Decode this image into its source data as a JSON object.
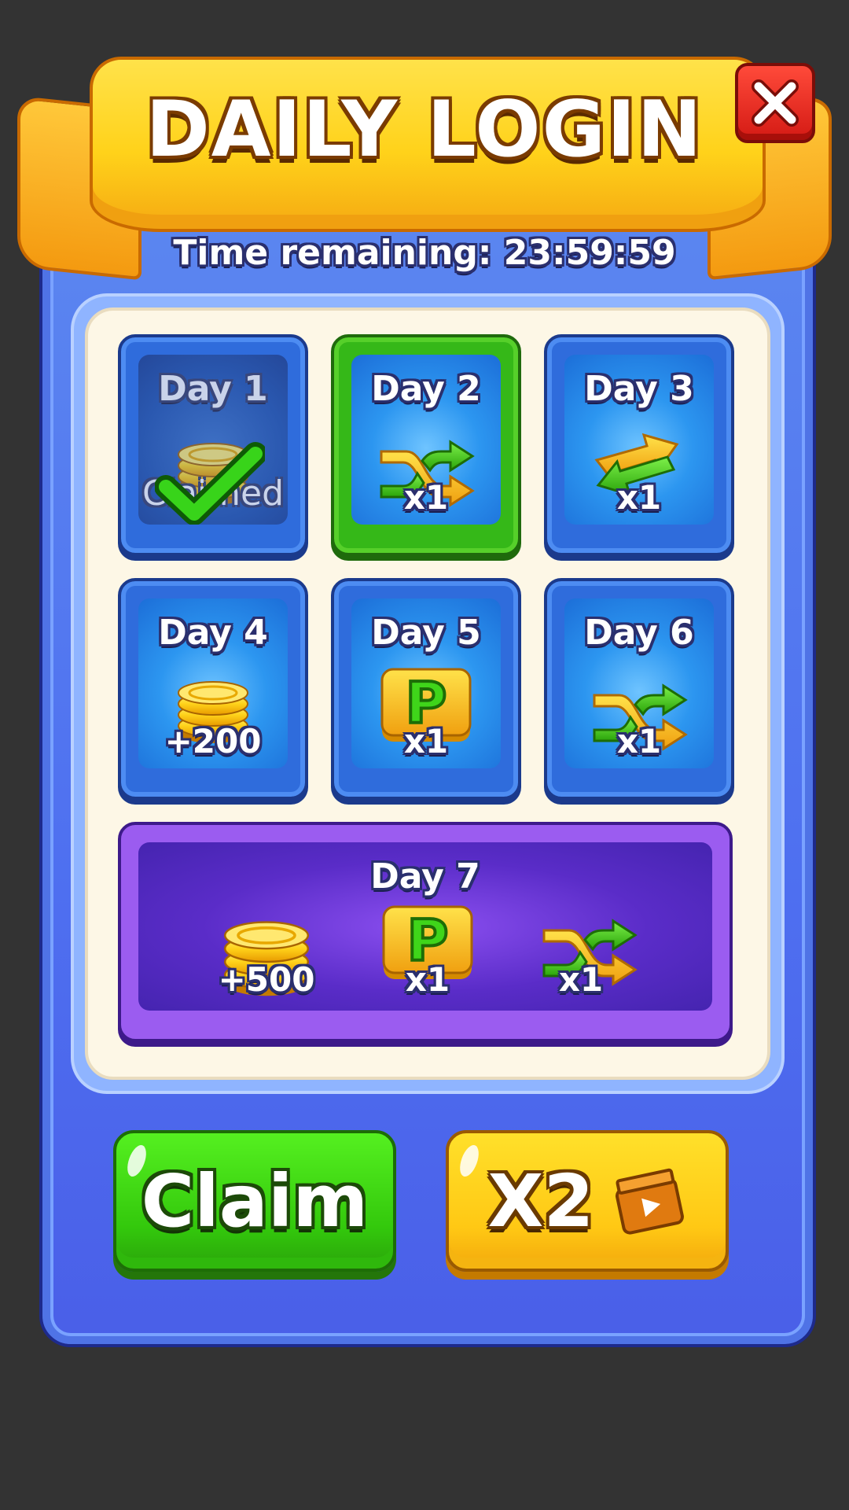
{
  "header": {
    "title": "DAILY LOGIN"
  },
  "timer": {
    "text": "Time remaining: 23:59:59"
  },
  "days": [
    {
      "label": "Day 1",
      "status": "claimed",
      "claimed_text": "Claimed",
      "icon": "coin-stack-icon"
    },
    {
      "label": "Day 2",
      "status": "active",
      "qty": "x1",
      "icon": "shuffle-icon"
    },
    {
      "label": "Day 3",
      "status": "locked",
      "qty": "x1",
      "icon": "swap-arrows-icon"
    },
    {
      "label": "Day 4",
      "status": "locked",
      "qty": "+200",
      "icon": "coin-stack-icon"
    },
    {
      "label": "Day 5",
      "status": "locked",
      "qty": "x1",
      "icon": "p-powerup-icon"
    },
    {
      "label": "Day 6",
      "status": "locked",
      "qty": "x1",
      "icon": "shuffle-icon"
    }
  ],
  "day7": {
    "label": "Day 7",
    "rewards": [
      {
        "qty": "+500",
        "icon": "coin-pile-icon"
      },
      {
        "qty": "x1",
        "icon": "p-powerup-icon"
      },
      {
        "qty": "x1",
        "icon": "shuffle-icon"
      }
    ]
  },
  "buttons": {
    "claim": "Claim",
    "double": "X2",
    "double_icon": "video-ad-icon"
  },
  "colors": {
    "panel": "#4e6ff0",
    "ribbon": "#ffd21a",
    "active": "#35b818",
    "day7": "#9b5cf0",
    "claim": "#33c80c",
    "double": "#ffc814",
    "close": "#d41a14"
  }
}
